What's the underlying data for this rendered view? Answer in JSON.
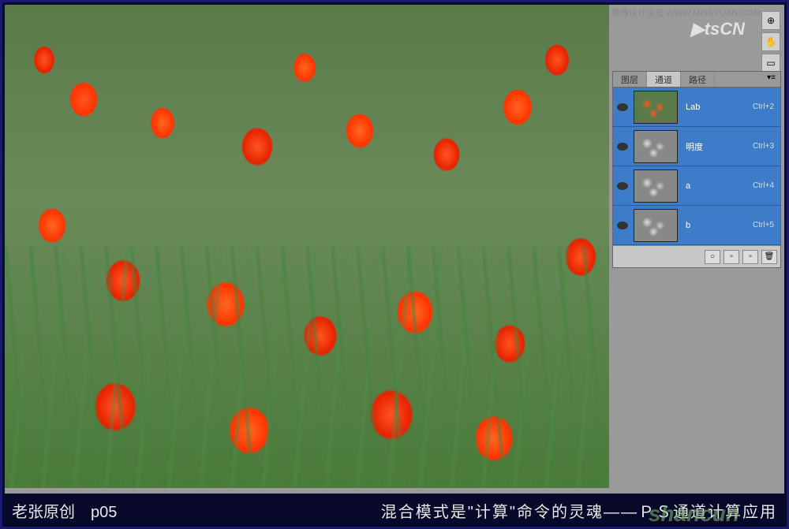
{
  "watermarks": {
    "top_text": "思缘设计论坛 WWW.MISSYUAN.COM",
    "logo": "▶tsCN",
    "bottom": "shancun"
  },
  "panel": {
    "tabs": {
      "layers": "图层",
      "channels": "通道",
      "paths": "路径"
    },
    "channels": [
      {
        "name": "Lab",
        "shortcut": "Ctrl+2",
        "thumb": "color"
      },
      {
        "name": "明度",
        "shortcut": "Ctrl+3",
        "thumb": "gray"
      },
      {
        "name": "a",
        "shortcut": "Ctrl+4",
        "thumb": "gray"
      },
      {
        "name": "b",
        "shortcut": "Ctrl+5",
        "thumb": "gray"
      }
    ]
  },
  "tools": {
    "icon1": "⊕",
    "icon2": "✋",
    "icon3": "▭"
  },
  "caption": {
    "left": "老张原创　p05",
    "right": "混合模式是\"计算\"命令的灵魂——ＰＳ通道计算应用"
  },
  "panel_buttons": {
    "circle": "○",
    "mask": "▫",
    "new": "▫",
    "trash": "🗑"
  }
}
